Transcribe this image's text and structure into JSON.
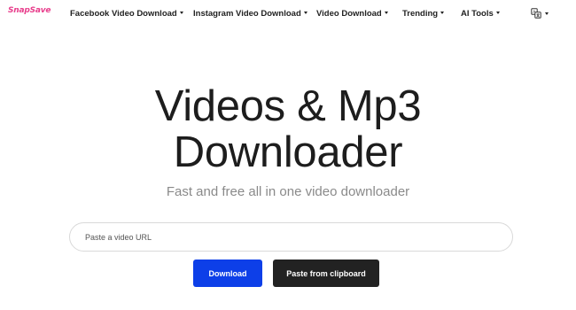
{
  "brand": {
    "logo_text": "SnapSave",
    "accent_color": "#e83e8c"
  },
  "nav": {
    "items": [
      {
        "label": "Facebook Video Download",
        "has_dropdown": true
      },
      {
        "label": "Instagram Video Download",
        "has_dropdown": true
      },
      {
        "label": "Video Download",
        "has_dropdown": true
      },
      {
        "label": "Trending",
        "has_dropdown": true
      },
      {
        "label": "AI Tools",
        "has_dropdown": true
      }
    ],
    "language_icon": "translate-icon"
  },
  "hero": {
    "title_line1": "Videos & Mp3",
    "title_line2": "Downloader",
    "subtitle": "Fast and free all in one video downloader"
  },
  "url_input": {
    "placeholder": "Paste a video URL",
    "value": ""
  },
  "buttons": {
    "download_label": "Download",
    "download_color": "#0d3fe8",
    "paste_label": "Paste from clipboard",
    "paste_color": "#222222"
  }
}
